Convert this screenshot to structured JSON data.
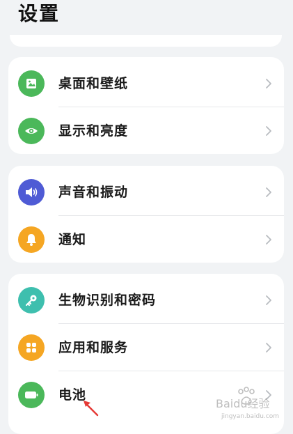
{
  "header": {
    "title": "设置"
  },
  "groups": [
    {
      "items": [
        {
          "label": "桌面和壁纸",
          "icon": "wallpaper-icon",
          "color": "#4bb85a"
        },
        {
          "label": "显示和亮度",
          "icon": "eye-icon",
          "color": "#4bb85a"
        }
      ]
    },
    {
      "items": [
        {
          "label": "声音和振动",
          "icon": "speaker-icon",
          "color": "#4f5bd5"
        },
        {
          "label": "通知",
          "icon": "bell-icon",
          "color": "#f5a623"
        }
      ]
    },
    {
      "items": [
        {
          "label": "生物识别和密码",
          "icon": "key-icon",
          "color": "#3ebfae"
        },
        {
          "label": "应用和服务",
          "icon": "apps-grid-icon",
          "color": "#f5a623"
        },
        {
          "label": "电池",
          "icon": "battery-icon",
          "color": "#4bb85a"
        }
      ]
    }
  ],
  "annotation": {
    "arrow_color": "#e53935"
  },
  "watermark": {
    "text": "Baidu经验",
    "subtext": "jingyan.baidu.com"
  }
}
